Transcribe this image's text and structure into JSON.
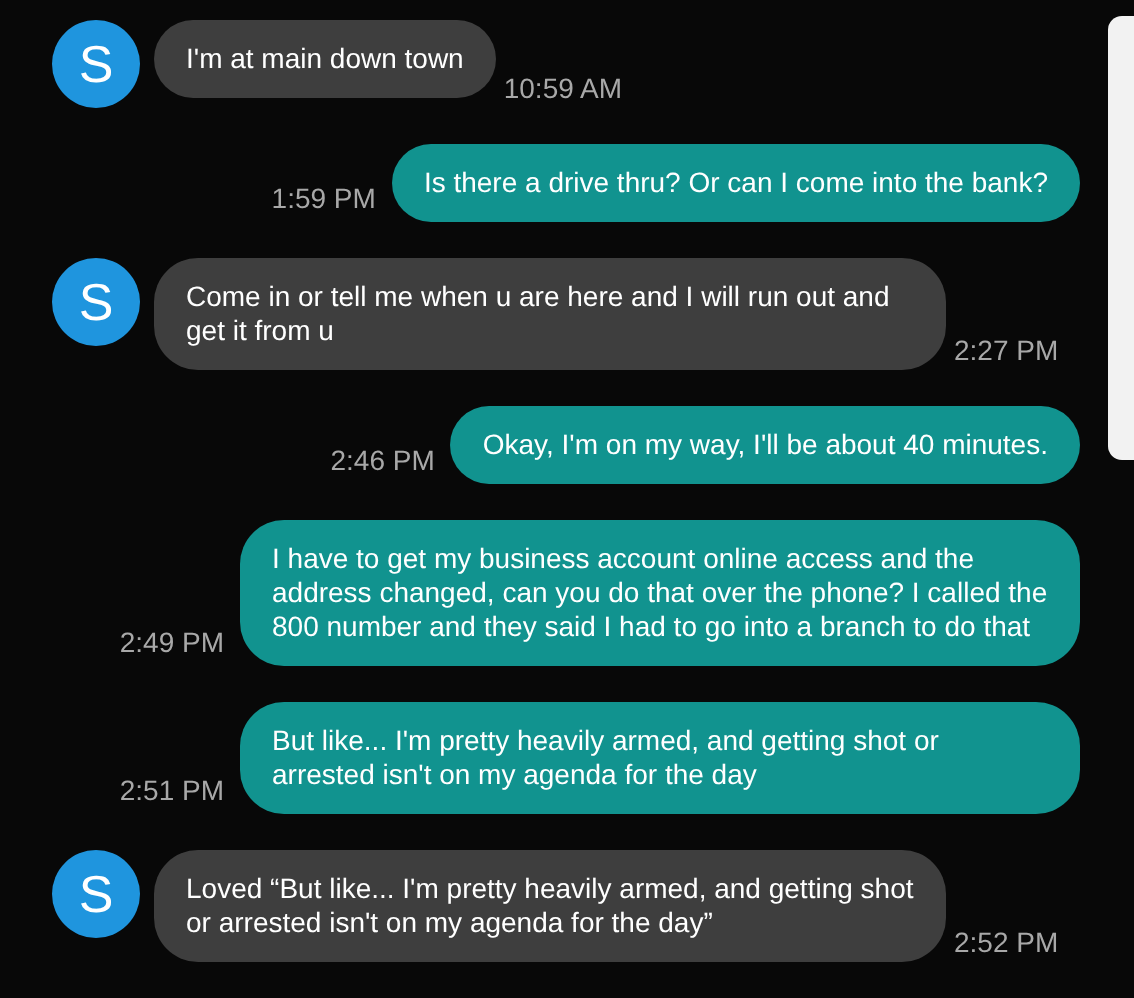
{
  "messages": [
    {
      "kind": "incoming",
      "avatar": "S",
      "text": "I'm at main down town",
      "time": "10:59 AM"
    },
    {
      "kind": "outgoing",
      "text": "Is there a drive thru? Or can I come into the bank?",
      "time": "1:59 PM"
    },
    {
      "kind": "incoming",
      "avatar": "S",
      "text": "Come in or tell me when u are here and I will run out and get it from u",
      "time": "2:27 PM"
    },
    {
      "kind": "outgoing",
      "text": "Okay, I'm on my way, I'll be about 40 minutes.",
      "time": "2:46 PM"
    },
    {
      "kind": "outgoing",
      "text": "I have to get my business account online access and the address changed, can you do that over the phone? I called the 800 number and they said I had to go into a branch to do that",
      "time": "2:49 PM"
    },
    {
      "kind": "outgoing",
      "text": "But like... I'm pretty heavily armed, and getting shot or arrested isn't on my agenda for the day",
      "time": "2:51 PM"
    },
    {
      "kind": "incoming",
      "avatar": "S",
      "text": "Loved “But like... I'm pretty heavily armed, and getting shot or arrested isn't on my agenda for the day”",
      "time": "2:52 PM"
    }
  ]
}
